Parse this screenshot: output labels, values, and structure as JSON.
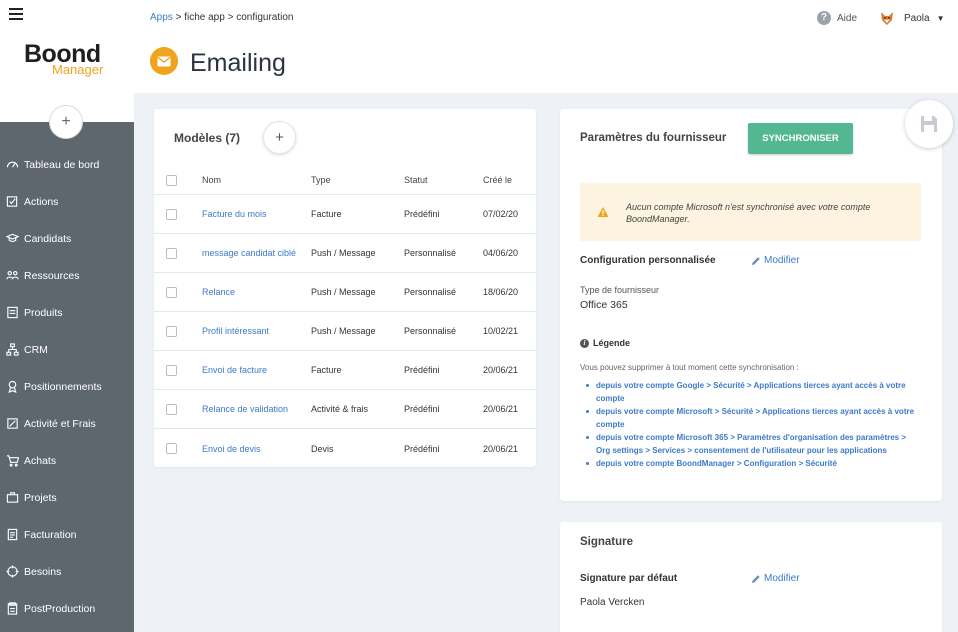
{
  "breadcrumb": {
    "apps": "Apps",
    "sep1": " > ",
    "fiche": "fiche app",
    "sep2": " > ",
    "config": "configuration"
  },
  "header": {
    "help": "Aide",
    "help_icon": "?",
    "user": "Paola",
    "caret": "▼"
  },
  "logo": {
    "line1": "Boond",
    "line2": "Manager"
  },
  "page_title": "Emailing",
  "sidebar": {
    "add": "+",
    "items": [
      {
        "label": "Tableau de bord",
        "icon": "dashboard-icon"
      },
      {
        "label": "Actions",
        "icon": "actions-icon"
      },
      {
        "label": "Candidats",
        "icon": "candidates-icon"
      },
      {
        "label": "Ressources",
        "icon": "resources-icon"
      },
      {
        "label": "Produits",
        "icon": "products-icon"
      },
      {
        "label": "CRM",
        "icon": "crm-icon"
      },
      {
        "label": "Positionnements",
        "icon": "positioning-icon"
      },
      {
        "label": "Activité et Frais",
        "icon": "activity-icon"
      },
      {
        "label": "Achats",
        "icon": "cart-icon"
      },
      {
        "label": "Projets",
        "icon": "projects-icon"
      },
      {
        "label": "Facturation",
        "icon": "billing-icon"
      },
      {
        "label": "Besoins",
        "icon": "needs-icon"
      },
      {
        "label": "PostProduction",
        "icon": "postproduction-icon"
      }
    ]
  },
  "models": {
    "title": "Modèles (7)",
    "add": "+",
    "columns": [
      "Nom",
      "Type",
      "Statut",
      "Créé le"
    ],
    "rows": [
      {
        "name": "Facture du mois",
        "type": "Facture",
        "status": "Prédéfini",
        "date": "07/02/20"
      },
      {
        "name": "message candidat ciblé",
        "type": "Push / Message",
        "status": "Personnalisé",
        "date": "04/06/20"
      },
      {
        "name": "Relance",
        "type": "Push / Message",
        "status": "Personnalisé",
        "date": "18/06/20"
      },
      {
        "name": "Profil intéressant",
        "type": "Push / Message",
        "status": "Personnalisé",
        "date": "10/02/21"
      },
      {
        "name": "Envoi de facture",
        "type": "Facture",
        "status": "Prédéfini",
        "date": "20/06/21"
      },
      {
        "name": "Relance de validation",
        "type": "Activité & frais",
        "status": "Prédéfini",
        "date": "20/06/21"
      },
      {
        "name": "Envoi de devis",
        "type": "Devis",
        "status": "Prédéfini",
        "date": "20/06/21"
      }
    ]
  },
  "params": {
    "title": "Paramètres du fournisseur",
    "sync_button": "SYNCHRONISER",
    "warning": "Aucun compte Microsoft n'est synchronisé avec votre compte BoondManager.",
    "config_label": "Configuration personnalisée",
    "modify": "Modifier",
    "provider_type_label": "Type de fournisseur",
    "provider_type_value": "Office 365",
    "legend_title": "Légende",
    "legend_intro": "Vous pouvez supprimer à tout moment cette synchronisation :",
    "legend_items": [
      "depuis votre compte Google > Sécurité > Applications tierces ayant accès à votre compte",
      "depuis votre compte Microsoft > Sécurité > Applications tierces ayant accès à votre compte",
      "depuis votre compte Microsoft 365 > Paramètres d'organisation des paramètres > Org settings > Services > consentement de l'utilisateur pour les applications",
      "depuis votre compte BoondManager > Configuration > Sécurité"
    ]
  },
  "signature": {
    "title": "Signature",
    "default_label": "Signature par défaut",
    "modify": "Modifier",
    "value": "Paola Vercken"
  },
  "colors": {
    "accent": "#f0a31c",
    "link": "#3d7ac8",
    "sync": "#53b792",
    "sidebar": "#5f676e"
  }
}
